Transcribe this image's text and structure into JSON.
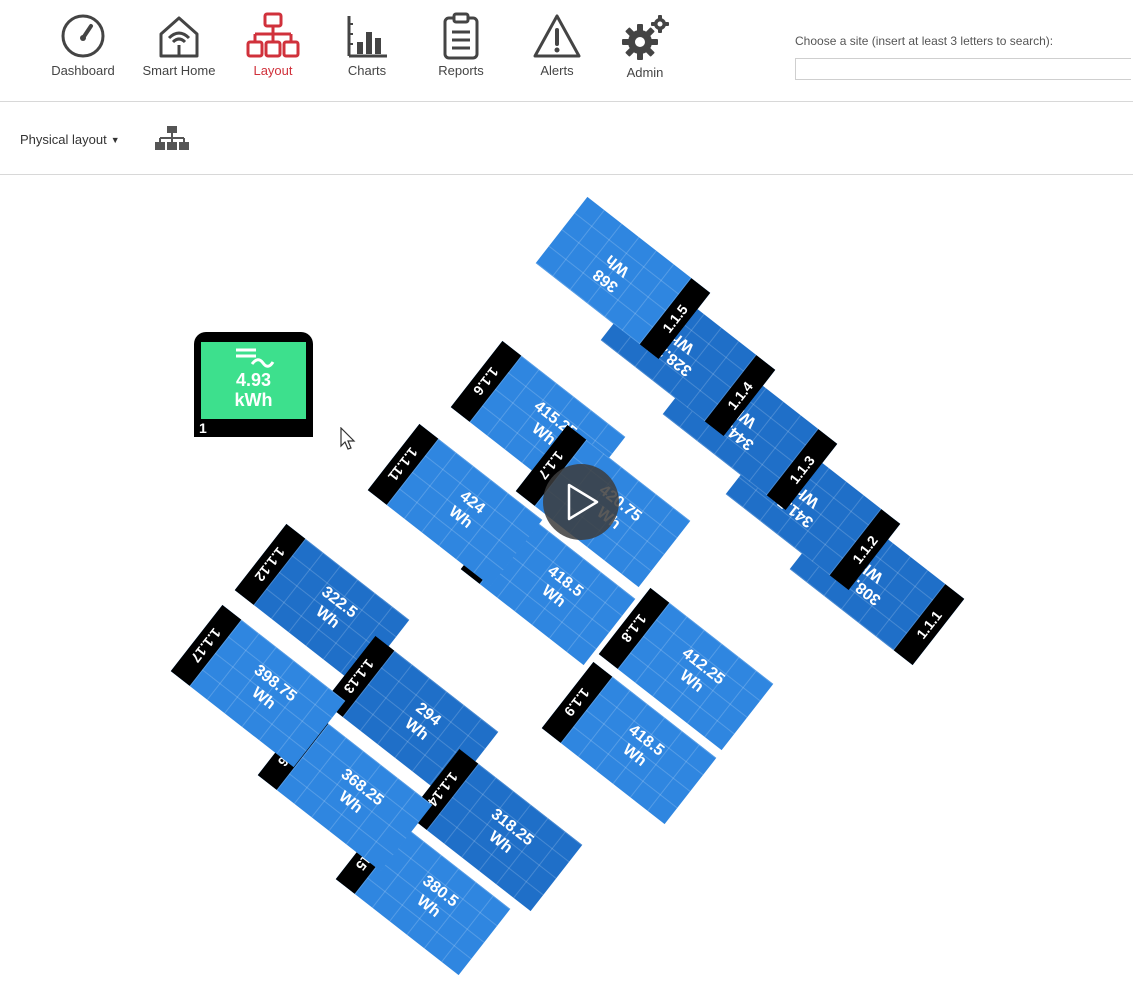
{
  "nav": {
    "items": [
      {
        "label": "Dashboard"
      },
      {
        "label": "Smart Home"
      },
      {
        "label": "Layout"
      },
      {
        "label": "Charts"
      },
      {
        "label": "Reports"
      },
      {
        "label": "Alerts"
      },
      {
        "label": "Admin"
      }
    ],
    "active": "Layout",
    "active_color": "#d0313b"
  },
  "site_search": {
    "label": "Choose a site (insert at least 3 letters to search):",
    "value": ""
  },
  "toolbar": {
    "layout_select": "Physical layout"
  },
  "inverter": {
    "value": "4.93",
    "unit": "kWh",
    "id": "1",
    "color": "#3de08d"
  },
  "panel_colors": {
    "light": "#2f86e0",
    "dark": "#1f6fc8"
  },
  "panels": [
    {
      "id": "1.1.1",
      "value": "308.25",
      "unit": "Wh"
    },
    {
      "id": "1.1.2",
      "value": "341.5",
      "unit": "Wh"
    },
    {
      "id": "1.1.3",
      "value": "344.75",
      "unit": "Wh"
    },
    {
      "id": "1.1.4",
      "value": "328.25",
      "unit": "Wh"
    },
    {
      "id": "1.1.5",
      "value": "368",
      "unit": "Wh"
    },
    {
      "id": "1.1.6",
      "value": "415.25",
      "unit": "Wh"
    },
    {
      "id": "1.1.7",
      "value": "420.75",
      "unit": "Wh"
    },
    {
      "id": "1.1.8",
      "value": "412.25",
      "unit": "Wh"
    },
    {
      "id": "1.1.9",
      "value": "418.5",
      "unit": "Wh"
    },
    {
      "id": "1.1.10",
      "value": "418.5",
      "unit": "Wh"
    },
    {
      "id": "1.1.11",
      "value": "424",
      "unit": "Wh"
    },
    {
      "id": "1.1.12",
      "value": "322.5",
      "unit": "Wh"
    },
    {
      "id": "1.1.13",
      "value": "294",
      "unit": "Wh"
    },
    {
      "id": "1.1.14",
      "value": "318.25",
      "unit": "Wh"
    },
    {
      "id": "1.1.15",
      "value": "380.5",
      "unit": "Wh"
    },
    {
      "id": "1.1.16",
      "value": "368.25",
      "unit": "Wh"
    },
    {
      "id": "1.1.17",
      "value": "398.75",
      "unit": "Wh"
    }
  ]
}
